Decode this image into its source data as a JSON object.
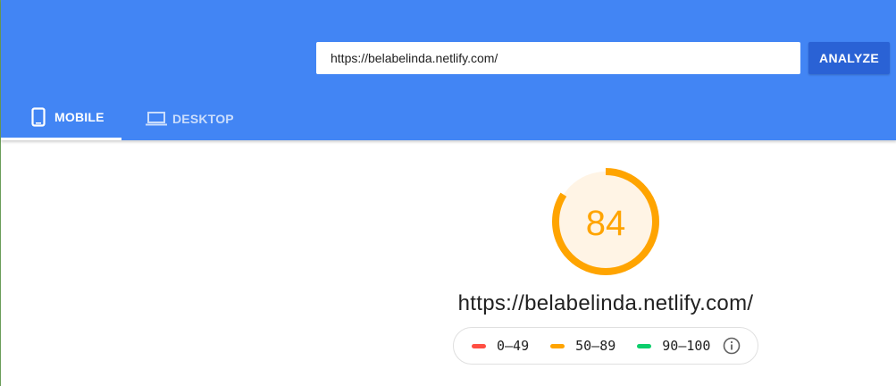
{
  "search": {
    "url_value": "https://belabelinda.netlify.com/",
    "analyze_label": "ANALYZE"
  },
  "tabs": [
    {
      "label": "MOBILE",
      "icon": "phone-icon",
      "active": true
    },
    {
      "label": "DESKTOP",
      "icon": "laptop-icon",
      "active": false
    }
  ],
  "report": {
    "score": "84",
    "score_fraction": 0.84,
    "url": "https://belabelinda.netlify.com/"
  },
  "legend": {
    "items": [
      {
        "label": "0–49",
        "color": "#ff4e42"
      },
      {
        "label": "50–89",
        "color": "#ffa400"
      },
      {
        "label": "90–100",
        "color": "#0cce6b"
      }
    ],
    "info_icon": "info-icon"
  },
  "colors": {
    "header": "#4285f4",
    "analyze_button": "#2a62d5",
    "gauge_stroke": "#ffa400",
    "gauge_fill": "#fff4e5"
  }
}
